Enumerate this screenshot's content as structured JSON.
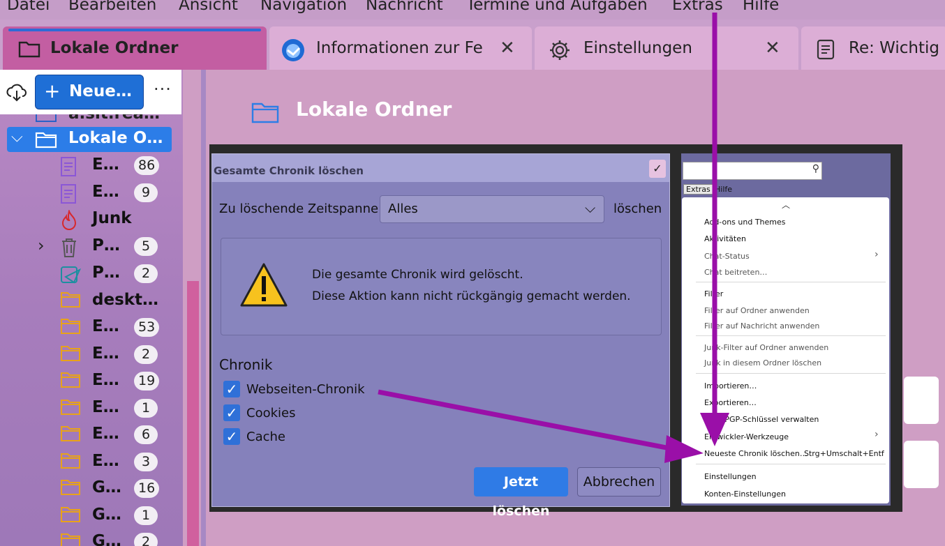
{
  "menubar": [
    "Datei",
    "Bearbeiten",
    "Ansicht",
    "Navigation",
    "Nachricht",
    "Termine und Aufgaben",
    "Extras",
    "Hilfe"
  ],
  "tabs": [
    {
      "label": "Lokale Ordner",
      "icon": "folder-icon",
      "active": true
    },
    {
      "label": "Informationen zur Fe",
      "icon": "thunderbird-logo-icon",
      "closable": true
    },
    {
      "label": "Einstellungen",
      "icon": "gear-icon",
      "closable": true
    },
    {
      "label": "Re: Wichtig",
      "icon": "message-icon"
    }
  ],
  "toolbar": {
    "new_label": "Neue…",
    "more": "···"
  },
  "folders": [
    {
      "name": "a.sit.rea…",
      "icon": "account-icon"
    },
    {
      "name": "Lokale O…",
      "icon": "folder-icon",
      "selected": true
    },
    {
      "name": "E…",
      "icon": "drafts-icon",
      "count": "86"
    },
    {
      "name": "E…",
      "icon": "drafts-icon",
      "count": "9"
    },
    {
      "name": "Junk",
      "icon": "junk-fire-icon"
    },
    {
      "name": "P…",
      "icon": "trash-icon",
      "count": "5"
    },
    {
      "name": "P…",
      "icon": "outbox-icon",
      "count": "2"
    },
    {
      "name": "deskt…",
      "icon": "folder-icon"
    },
    {
      "name": "E…",
      "icon": "folder-icon",
      "count": "53"
    },
    {
      "name": "E…",
      "icon": "folder-icon",
      "count": "2"
    },
    {
      "name": "E…",
      "icon": "folder-icon",
      "count": "19"
    },
    {
      "name": "E…",
      "icon": "folder-icon",
      "count": "1"
    },
    {
      "name": "E…",
      "icon": "folder-icon",
      "count": "6"
    },
    {
      "name": "E…",
      "icon": "folder-icon",
      "count": "3"
    },
    {
      "name": "G…",
      "icon": "folder-icon",
      "count": "16"
    },
    {
      "name": "G…",
      "icon": "folder-icon",
      "count": "1"
    },
    {
      "name": "G…",
      "icon": "folder-icon",
      "count": "2"
    }
  ],
  "main": {
    "title": "Lokale Ordner"
  },
  "dialog": {
    "title": "Gesamte Chronik löschen",
    "timespan_label": "Zu löschende Zeitspanne:",
    "timespan_value": "Alles",
    "timespan_suffix": "löschen",
    "warning_line1": "Die gesamte Chronik wird gelöscht.",
    "warning_line2": "Diese Aktion kann nicht rückgängig gemacht werden.",
    "section": "Chronik",
    "checks": [
      "Webseiten-Chronik",
      "Cookies",
      "Cache"
    ],
    "primary_button": "Jetzt löschen",
    "secondary_button": "Abbrechen"
  },
  "extras_menu": {
    "menubar": [
      "Extras",
      "Hilfe"
    ],
    "items": [
      {
        "label": "Add-ons und Themes"
      },
      {
        "label": "Aktivitäten"
      },
      {
        "label": "Chat-Status",
        "dim": true
      },
      {
        "label": "Chat beitreten…",
        "dim": true
      },
      {
        "label": "Filter"
      },
      {
        "label": "Filter auf Ordner anwenden",
        "dim": true
      },
      {
        "label": "Filter auf Nachricht anwenden",
        "dim": true
      },
      {
        "label": "Junk-Filter auf Ordner anwenden",
        "dim": true
      },
      {
        "label": "Junk in diesem Ordner löschen",
        "dim": true
      },
      {
        "label": "Importieren…"
      },
      {
        "label": "Exportieren…"
      },
      {
        "label": "OpenPGP-Schlüssel verwalten"
      },
      {
        "label": "Entwickler-Werkzeuge"
      },
      {
        "label": "Neueste Chronik löschen…",
        "shortcut": "Strg+Umschalt+Entf"
      },
      {
        "label": "Einstellungen"
      },
      {
        "label": "Konten-Einstellungen"
      }
    ]
  },
  "colors": {
    "arrow": "#9a0fa8",
    "accent": "#2c7de8"
  }
}
